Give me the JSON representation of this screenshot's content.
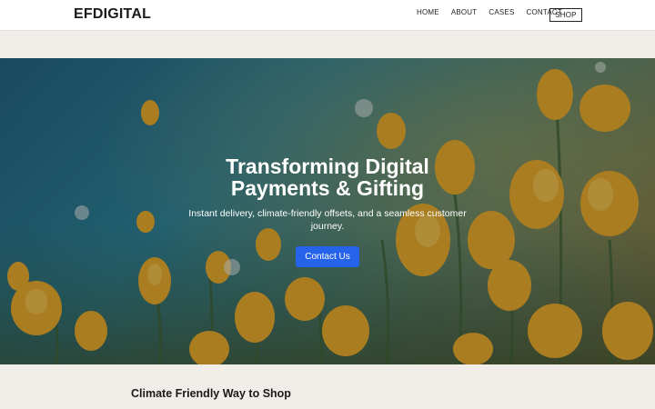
{
  "header": {
    "logo": "EFDIGITAL",
    "nav": {
      "home": "HOME",
      "about": "ABOUT",
      "cases": "CASES",
      "contact": "CONTACT",
      "shop": "SHOP"
    }
  },
  "hero": {
    "title_line1": "Transforming Digital",
    "title_line2": "Payments & Gifting",
    "subtitle": "Instant delivery, climate-friendly offsets, and a seamless customer journey.",
    "cta": "Contact Us",
    "image": "yellow-poppies-field",
    "cta_color": "#2563eb"
  },
  "section": {
    "title": "Climate Friendly Way to Shop"
  }
}
